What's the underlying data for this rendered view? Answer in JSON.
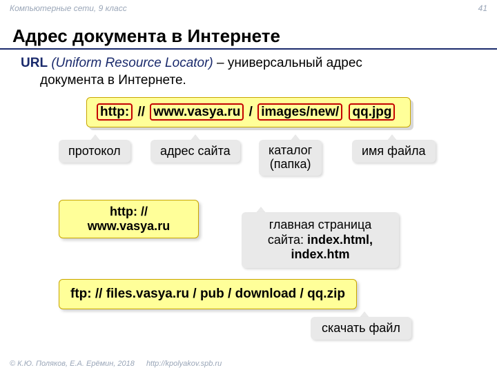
{
  "header": {
    "left": "Компьютерные сети, 9 класс",
    "page": "41"
  },
  "title": "Адрес документа в Интернете",
  "intro": {
    "term": "URL",
    "paren": "(Uniform Resource Locator)",
    "rest1": " – универсальный адрес",
    "rest2": "документа в Интернете."
  },
  "url_parts": {
    "p1": "http:",
    "sep1": " // ",
    "p2": "www.vasya.ru",
    "sep2": " / ",
    "p3": "images/new/",
    "sep3": " ",
    "p4": "qq.jpg"
  },
  "labels": {
    "protocol": "протокол",
    "site": "адрес сайта",
    "folder_l1": "каталог",
    "folder_l2": "(папка)",
    "filename": "имя файла"
  },
  "yellow_sub": {
    "l1": "http: //",
    "l2": "www.vasya.ru"
  },
  "main_page": {
    "l1": "главная страница",
    "l2": "сайта: ",
    "l2b": "index.html,",
    "l3": "index.htm"
  },
  "ftp": "ftp: // files.vasya.ru / pub / download / qq.zip",
  "download": "скачать файл",
  "footer": {
    "copy": "© К.Ю. Поляков, Е.А. Ерёмин, 2018",
    "link": "http://kpolyakov.spb.ru"
  }
}
